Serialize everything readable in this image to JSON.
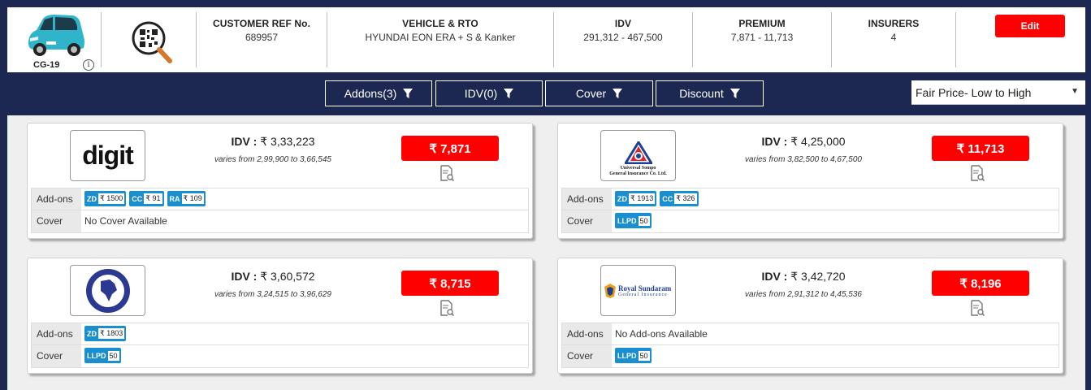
{
  "header": {
    "vehicle_reg": "CG-19",
    "info_glyph": "i",
    "customer_ref": {
      "label": "CUSTOMER REF No.",
      "value": "689957"
    },
    "vehicle_rto": {
      "label": "VEHICLE & RTO",
      "value": "HYUNDAI EON ERA + S & Kanker"
    },
    "idv": {
      "label": "IDV",
      "value": "291,312 - 467,500"
    },
    "premium": {
      "label": "PREMIUM",
      "value": "7,871 - 11,713"
    },
    "insurers": {
      "label": "INSURERS",
      "value": "4"
    },
    "edit_label": "Edit"
  },
  "filters": [
    {
      "label": "Addons(3)",
      "icon": "filter-icon"
    },
    {
      "label": "IDV(0)",
      "icon": "filter-icon"
    },
    {
      "label": "Cover",
      "icon": "filter-icon"
    },
    {
      "label": "Discount",
      "icon": "filter-icon"
    }
  ],
  "sort": {
    "selected": "Fair Price- Low to High",
    "arrow": "▼"
  },
  "row_labels": {
    "addons": "Add-ons",
    "cover": "Cover"
  },
  "cards": [
    {
      "insurer": "digit",
      "logo_text": "digit",
      "idv_label": "IDV :",
      "idv_value": "₹ 3,33,223",
      "varies": "varies from 2,99,900 to 3,66,545",
      "premium": "₹ 7,871",
      "addons": [
        {
          "code": "ZD",
          "value": "₹ 1500"
        },
        {
          "code": "CC",
          "value": "₹ 91"
        },
        {
          "code": "RA",
          "value": "₹ 109"
        }
      ],
      "addons_text": "",
      "covers": [],
      "cover_text": "No Cover Available"
    },
    {
      "insurer": "universal-sompo",
      "logo_text_line1": "Universal Sompo",
      "logo_text_line2": "General Insurance Co. Ltd.",
      "idv_label": "IDV :",
      "idv_value": "₹ 4,25,000",
      "varies": "varies from 3,82,500 to 4,67,500",
      "premium": "₹ 11,713",
      "addons": [
        {
          "code": "ZD",
          "value": "₹ 1913"
        },
        {
          "code": "CC",
          "value": "₹ 326"
        }
      ],
      "addons_text": "",
      "covers": [
        {
          "code": "LLPD",
          "value": "50"
        }
      ],
      "cover_text": ""
    },
    {
      "insurer": "national-insurance",
      "idv_label": "IDV :",
      "idv_value": "₹ 3,60,572",
      "varies": "varies from 3,24,515 to 3,96,629",
      "premium": "₹ 8,715",
      "addons": [
        {
          "code": "ZD",
          "value": "₹ 1803"
        }
      ],
      "addons_text": "",
      "covers": [
        {
          "code": "LLPD",
          "value": "50"
        }
      ],
      "cover_text": ""
    },
    {
      "insurer": "royal-sundaram",
      "logo_text_line1": "Royal Sundaram",
      "logo_text_line2": "General Insurance",
      "idv_label": "IDV :",
      "idv_value": "₹ 3,42,720",
      "varies": "varies from 2,91,312 to 4,45,536",
      "premium": "₹ 8,196",
      "addons": [],
      "addons_text": "No Add-ons Available",
      "covers": [
        {
          "code": "LLPD",
          "value": "50"
        }
      ],
      "cover_text": ""
    }
  ],
  "colors": {
    "navy": "#1c2851",
    "red": "#ff0000",
    "tag_blue": "#1a8fd0"
  }
}
